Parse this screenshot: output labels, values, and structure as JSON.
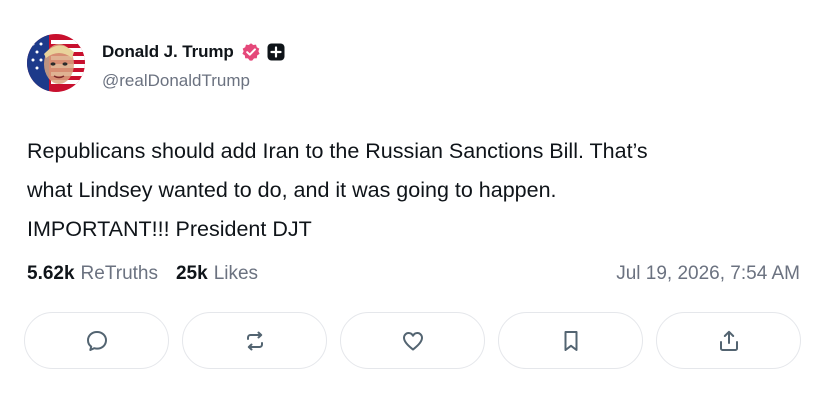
{
  "author": {
    "display_name": "Donald J. Trump",
    "handle": "@realDonaldTrump",
    "avatar_icon": "avatar-flag-portrait",
    "verified_icon": "verified-badge-icon",
    "verified_color": "#e5487a",
    "follow_icon": "plus-square-icon"
  },
  "post": {
    "lines": [
      "Republicans should add Iran to the Russian Sanctions Bill. That’s",
      "what Lindsey wanted to do, and it was going to happen.",
      "IMPORTANT!!! President DJT"
    ]
  },
  "stats": {
    "retruths_count": "5.62k",
    "retruths_label": "ReTruths",
    "likes_count": "25k",
    "likes_label": "Likes",
    "timestamp": "Jul 19, 2026, 7:54 AM"
  },
  "actions": [
    {
      "icon": "reply-icon"
    },
    {
      "icon": "retruth-icon"
    },
    {
      "icon": "like-icon"
    },
    {
      "icon": "bookmark-icon"
    },
    {
      "icon": "share-icon"
    }
  ]
}
